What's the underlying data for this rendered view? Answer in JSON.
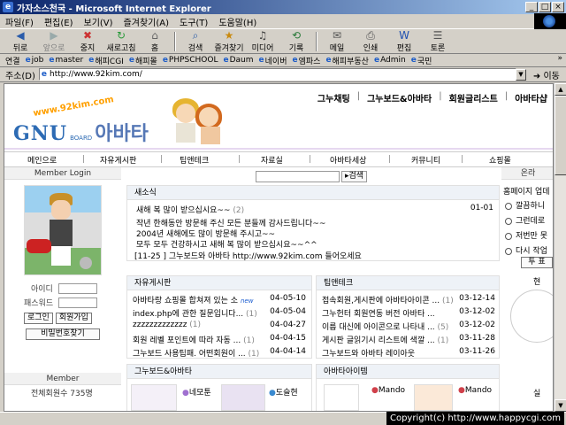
{
  "window": {
    "title": "가자소스천국 - Microsoft Internet Explorer",
    "controls": [
      "_",
      "□",
      "×"
    ]
  },
  "menubar": [
    "파일(F)",
    "편집(E)",
    "보기(V)",
    "즐겨찾기(A)",
    "도구(T)",
    "도움말(H)"
  ],
  "toolbar": [
    {
      "label": "뒤로",
      "icon": "back-arrow-icon",
      "enabled": true
    },
    {
      "label": "앞으로",
      "icon": "forward-arrow-icon",
      "enabled": false
    },
    {
      "label": "중지",
      "icon": "stop-icon",
      "enabled": true
    },
    {
      "label": "새로고침",
      "icon": "refresh-icon",
      "enabled": true
    },
    {
      "label": "홈",
      "icon": "home-icon",
      "enabled": true
    },
    {
      "label": "검색",
      "icon": "search-icon",
      "enabled": true
    },
    {
      "label": "즐겨찾기",
      "icon": "favorites-icon",
      "enabled": true
    },
    {
      "label": "미디어",
      "icon": "media-icon",
      "enabled": true
    },
    {
      "label": "기록",
      "icon": "history-icon",
      "enabled": true
    },
    {
      "label": "메일",
      "icon": "mail-icon",
      "enabled": true
    },
    {
      "label": "인쇄",
      "icon": "print-icon",
      "enabled": true
    },
    {
      "label": "편집",
      "icon": "edit-icon",
      "enabled": true
    },
    {
      "label": "토론",
      "icon": "discuss-icon",
      "enabled": true
    }
  ],
  "linksbar": {
    "label": "연결",
    "links": [
      "job",
      "master",
      "해피CGI",
      "해피몰",
      "PHPSCHOOL",
      "Daum",
      "네이버",
      "엠파스",
      "해피부동산",
      "Admin",
      "국민"
    ],
    "more": "»"
  },
  "addressbar": {
    "label": "주소(D)",
    "url": "http://www.92kim.com/",
    "go_label": "이동"
  },
  "site": {
    "topnav": [
      "그누채팅",
      "그누보드&아바타",
      "회원글리스트",
      "아바타샵"
    ],
    "logo_url": "www.92kim.com",
    "logo_gnu": "GNU",
    "logo_board": "BOARD",
    "logo_avatar": "아바타",
    "mainnav": [
      "메인으로",
      "자유게시판",
      "팁앤테크",
      "자료실",
      "아바타세상",
      "커뮤니티",
      "쇼핑몰"
    ],
    "login": {
      "title": "Member Login",
      "id_label": "아이디",
      "pw_label": "패스워드",
      "login_btn": "로그인",
      "join_btn": "회원가입",
      "find_btn": "비밀번호찾기"
    },
    "member": {
      "title": "Member",
      "total": "전체회원수 735명"
    },
    "search_btn": "▸검색",
    "news": {
      "title": "새소식",
      "first": {
        "text": "새해 복 많이 받으십시요~~",
        "count": "(2)",
        "date": "01-01"
      },
      "lines": [
        "작년 한해동안 방문해 주신 모든 분들께 감사드립니다~~",
        "2004년 새해에도 많이 방문해 주시고~~",
        "모두 모두 건강하시고 새해 복 많이 받으십시요~~^^"
      ],
      "notice": "[11-25 ] 그누보드와 아바타 http://www.92kim.com 들어오세요"
    },
    "free_board": {
      "title": "자유게시판",
      "rows": [
        {
          "text": "아바타랑 쇼핑몰 합쳐져 있는 소",
          "count": "",
          "new": "new",
          "date": "04-05-10"
        },
        {
          "text": "index.php에 관한 질문입니다...",
          "count": "(1)",
          "new": "",
          "date": "04-05-04"
        },
        {
          "text": "zzzzzzzzzzzzz",
          "count": "(1)",
          "new": "",
          "date": "04-04-27"
        },
        {
          "text": "회원 레벨 포인트에 따라 자동 ...",
          "count": "(1)",
          "new": "",
          "date": "04-04-15"
        },
        {
          "text": "그누보드 사용팁패. 어떤회원이 ...",
          "count": "(1)",
          "new": "",
          "date": "04-04-14"
        }
      ]
    },
    "tip_board": {
      "title": "팁앤테크",
      "rows": [
        {
          "text": "접속회원,게시판에 아바타아이콘 ...",
          "count": "(1)",
          "date": "03-12-14"
        },
        {
          "text": "그누헌터 회원연동 버전 아바타 ...",
          "count": "",
          "date": "03-12-02"
        },
        {
          "text": "이름 대신에 아이콘으로 나타내 ...",
          "count": "(5)",
          "date": "03-12-02"
        },
        {
          "text": "게시판 글읽기시 리스트에 색깔 ...",
          "count": "(1)",
          "date": "03-11-28"
        },
        {
          "text": "그누보드와 아바타 레이아웃",
          "count": "",
          "date": "03-11-26"
        }
      ]
    },
    "gnu_avatar_title": "그누보드&아바타",
    "avatar_item_title": "아바타아이템",
    "bottom_items": [
      "네모툰",
      "도슬현",
      "Mando",
      "Mando"
    ],
    "right_col": {
      "title": "온라",
      "poll_q": "홈페이지 업데",
      "options": [
        "깔끔하니",
        "그런데로",
        "저번만 못",
        "다시 작업"
      ],
      "vote_btn": "투 표",
      "current": "현",
      "bottom": "실"
    }
  },
  "status": {
    "copyright": "Copyright(c) http://www.happycgi.com"
  }
}
